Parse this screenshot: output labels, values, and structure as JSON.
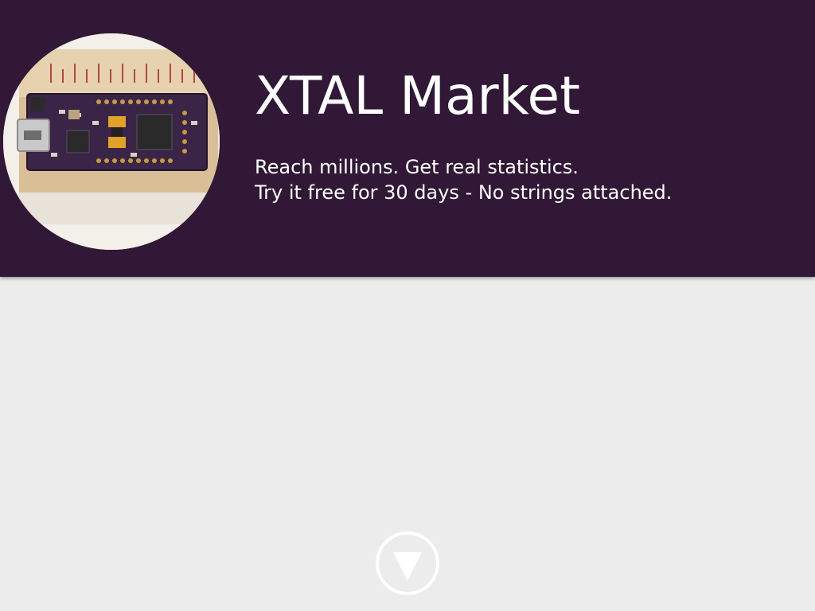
{
  "hero": {
    "title": "XTAL Market",
    "tagline_line1": "Reach millions. Get real statistics.",
    "tagline_line2": "Try it free for 30 days - No strings attached.",
    "background_color": "#311836",
    "text_color": "#ffffff"
  },
  "product_image": {
    "icon": "circuit-board-photo"
  },
  "scroll_button": {
    "icon": "down-triangle-icon"
  },
  "page": {
    "background_color": "#ececec"
  }
}
